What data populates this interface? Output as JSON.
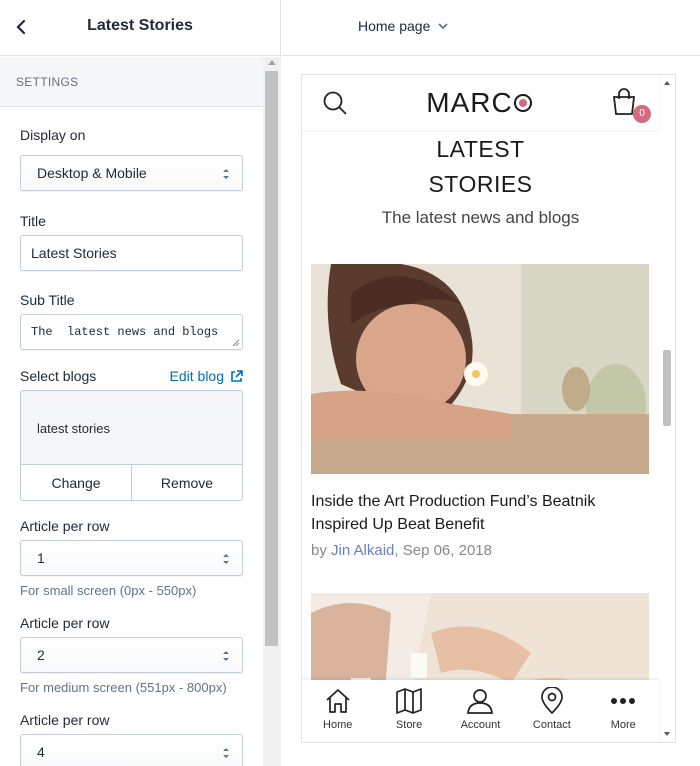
{
  "editor": {
    "back_icon": "chevron-left-icon",
    "title": "Latest Stories",
    "settings_heading": "SETTINGS",
    "display_on": {
      "label": "Display on",
      "value": "Desktop & Mobile"
    },
    "title_field": {
      "label": "Title",
      "value": "Latest Stories"
    },
    "sub_title_field": {
      "label": "Sub Title",
      "value": "The  latest news and blogs"
    },
    "select_blogs": {
      "label": "Select blogs",
      "edit_link": "Edit blog",
      "selected_blog": "latest stories",
      "change_label": "Change",
      "remove_label": "Remove"
    },
    "article_rows": [
      {
        "label": "Article per row",
        "value": "1",
        "help": "For small screen (0px - 550px)"
      },
      {
        "label": "Article per row",
        "value": "2",
        "help": "For medium screen (551px - 800px)"
      },
      {
        "label": "Article per row",
        "value": "4",
        "help": ""
      }
    ]
  },
  "preview": {
    "page_selector": "Home page",
    "shop": {
      "logo_left": "MARC",
      "cart_count": "0",
      "section_title_line1": "LATEST",
      "section_title_line2": "STORIES",
      "section_subtitle": "The latest news and blogs",
      "articles": [
        {
          "title": "Inside the Art Production Fund’s Beatnik Inspired Up Beat Benefit",
          "by": "by",
          "author": "Jin Alkaid",
          "date": ", Sep 06, 2018"
        }
      ],
      "bottom_nav": [
        {
          "label": "Home",
          "icon": "home-icon"
        },
        {
          "label": "Store",
          "icon": "map-icon"
        },
        {
          "label": "Account",
          "icon": "user-icon"
        },
        {
          "label": "Contact",
          "icon": "location-pin-icon"
        },
        {
          "label": "More",
          "icon": "more-dots-icon"
        }
      ]
    }
  },
  "colors": {
    "accent_link": "#006fbb",
    "brand_pink": "#d46a7e",
    "author_link": "#6b7ec7"
  }
}
